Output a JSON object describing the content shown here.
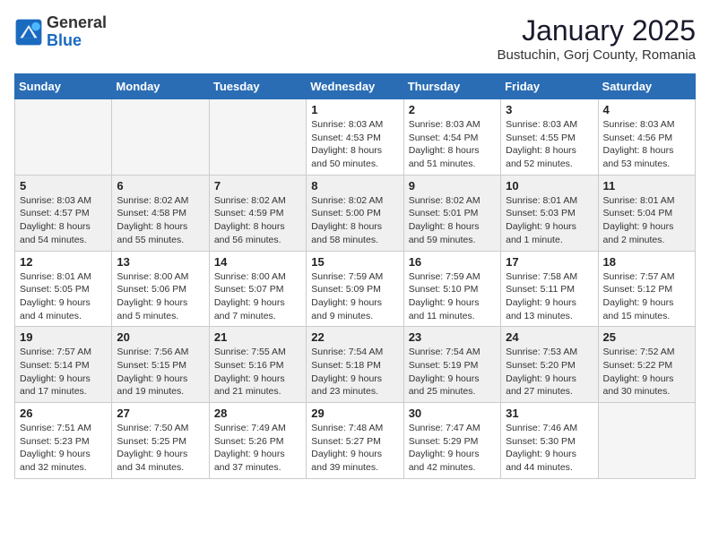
{
  "logo": {
    "general": "General",
    "blue": "Blue"
  },
  "header": {
    "month": "January 2025",
    "location": "Bustuchin, Gorj County, Romania"
  },
  "days_of_week": [
    "Sunday",
    "Monday",
    "Tuesday",
    "Wednesday",
    "Thursday",
    "Friday",
    "Saturday"
  ],
  "weeks": [
    [
      {
        "day": "",
        "info": ""
      },
      {
        "day": "",
        "info": ""
      },
      {
        "day": "",
        "info": ""
      },
      {
        "day": "1",
        "info": "Sunrise: 8:03 AM\nSunset: 4:53 PM\nDaylight: 8 hours\nand 50 minutes."
      },
      {
        "day": "2",
        "info": "Sunrise: 8:03 AM\nSunset: 4:54 PM\nDaylight: 8 hours\nand 51 minutes."
      },
      {
        "day": "3",
        "info": "Sunrise: 8:03 AM\nSunset: 4:55 PM\nDaylight: 8 hours\nand 52 minutes."
      },
      {
        "day": "4",
        "info": "Sunrise: 8:03 AM\nSunset: 4:56 PM\nDaylight: 8 hours\nand 53 minutes."
      }
    ],
    [
      {
        "day": "5",
        "info": "Sunrise: 8:03 AM\nSunset: 4:57 PM\nDaylight: 8 hours\nand 54 minutes."
      },
      {
        "day": "6",
        "info": "Sunrise: 8:02 AM\nSunset: 4:58 PM\nDaylight: 8 hours\nand 55 minutes."
      },
      {
        "day": "7",
        "info": "Sunrise: 8:02 AM\nSunset: 4:59 PM\nDaylight: 8 hours\nand 56 minutes."
      },
      {
        "day": "8",
        "info": "Sunrise: 8:02 AM\nSunset: 5:00 PM\nDaylight: 8 hours\nand 58 minutes."
      },
      {
        "day": "9",
        "info": "Sunrise: 8:02 AM\nSunset: 5:01 PM\nDaylight: 8 hours\nand 59 minutes."
      },
      {
        "day": "10",
        "info": "Sunrise: 8:01 AM\nSunset: 5:03 PM\nDaylight: 9 hours\nand 1 minute."
      },
      {
        "day": "11",
        "info": "Sunrise: 8:01 AM\nSunset: 5:04 PM\nDaylight: 9 hours\nand 2 minutes."
      }
    ],
    [
      {
        "day": "12",
        "info": "Sunrise: 8:01 AM\nSunset: 5:05 PM\nDaylight: 9 hours\nand 4 minutes."
      },
      {
        "day": "13",
        "info": "Sunrise: 8:00 AM\nSunset: 5:06 PM\nDaylight: 9 hours\nand 5 minutes."
      },
      {
        "day": "14",
        "info": "Sunrise: 8:00 AM\nSunset: 5:07 PM\nDaylight: 9 hours\nand 7 minutes."
      },
      {
        "day": "15",
        "info": "Sunrise: 7:59 AM\nSunset: 5:09 PM\nDaylight: 9 hours\nand 9 minutes."
      },
      {
        "day": "16",
        "info": "Sunrise: 7:59 AM\nSunset: 5:10 PM\nDaylight: 9 hours\nand 11 minutes."
      },
      {
        "day": "17",
        "info": "Sunrise: 7:58 AM\nSunset: 5:11 PM\nDaylight: 9 hours\nand 13 minutes."
      },
      {
        "day": "18",
        "info": "Sunrise: 7:57 AM\nSunset: 5:12 PM\nDaylight: 9 hours\nand 15 minutes."
      }
    ],
    [
      {
        "day": "19",
        "info": "Sunrise: 7:57 AM\nSunset: 5:14 PM\nDaylight: 9 hours\nand 17 minutes."
      },
      {
        "day": "20",
        "info": "Sunrise: 7:56 AM\nSunset: 5:15 PM\nDaylight: 9 hours\nand 19 minutes."
      },
      {
        "day": "21",
        "info": "Sunrise: 7:55 AM\nSunset: 5:16 PM\nDaylight: 9 hours\nand 21 minutes."
      },
      {
        "day": "22",
        "info": "Sunrise: 7:54 AM\nSunset: 5:18 PM\nDaylight: 9 hours\nand 23 minutes."
      },
      {
        "day": "23",
        "info": "Sunrise: 7:54 AM\nSunset: 5:19 PM\nDaylight: 9 hours\nand 25 minutes."
      },
      {
        "day": "24",
        "info": "Sunrise: 7:53 AM\nSunset: 5:20 PM\nDaylight: 9 hours\nand 27 minutes."
      },
      {
        "day": "25",
        "info": "Sunrise: 7:52 AM\nSunset: 5:22 PM\nDaylight: 9 hours\nand 30 minutes."
      }
    ],
    [
      {
        "day": "26",
        "info": "Sunrise: 7:51 AM\nSunset: 5:23 PM\nDaylight: 9 hours\nand 32 minutes."
      },
      {
        "day": "27",
        "info": "Sunrise: 7:50 AM\nSunset: 5:25 PM\nDaylight: 9 hours\nand 34 minutes."
      },
      {
        "day": "28",
        "info": "Sunrise: 7:49 AM\nSunset: 5:26 PM\nDaylight: 9 hours\nand 37 minutes."
      },
      {
        "day": "29",
        "info": "Sunrise: 7:48 AM\nSunset: 5:27 PM\nDaylight: 9 hours\nand 39 minutes."
      },
      {
        "day": "30",
        "info": "Sunrise: 7:47 AM\nSunset: 5:29 PM\nDaylight: 9 hours\nand 42 minutes."
      },
      {
        "day": "31",
        "info": "Sunrise: 7:46 AM\nSunset: 5:30 PM\nDaylight: 9 hours\nand 44 minutes."
      },
      {
        "day": "",
        "info": ""
      }
    ]
  ]
}
